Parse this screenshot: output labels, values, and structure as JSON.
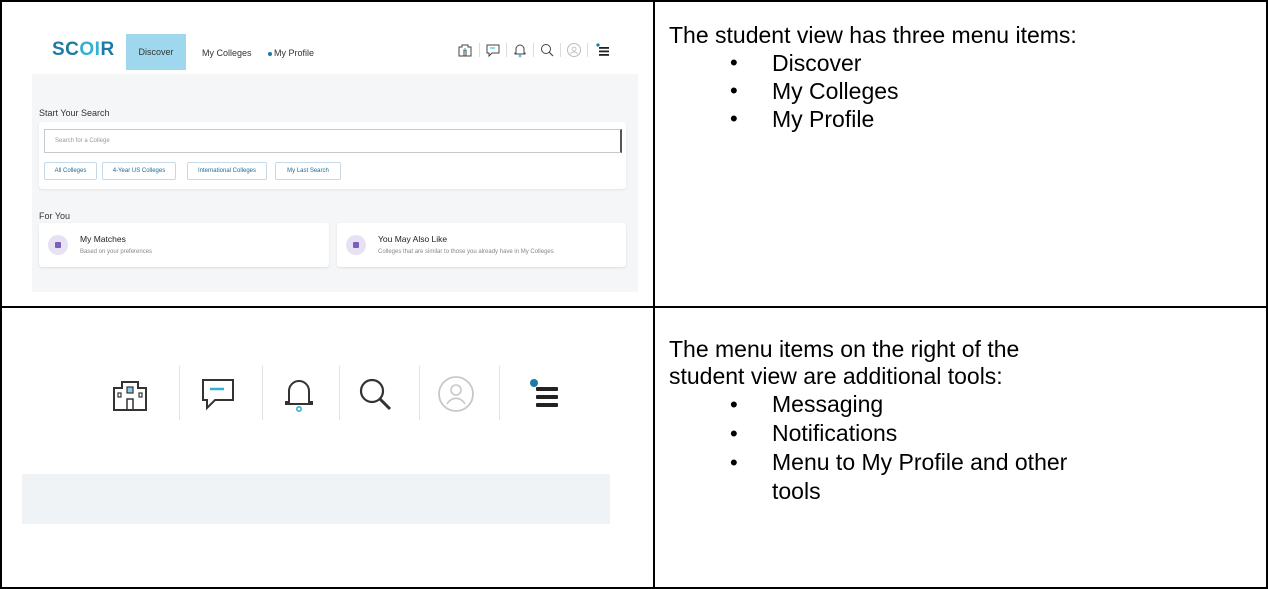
{
  "row1": {
    "screenshot": {
      "logo": {
        "prefix": "SC",
        "oo": "OI",
        "suffix": "R",
        "colors": {
          "dark": "#1b7ba5",
          "light": "#33b0d6"
        }
      },
      "tabs": [
        {
          "label": "Discover",
          "active": true
        },
        {
          "label": "My Colleges"
        },
        {
          "label": "My Profile",
          "indicator": "dot"
        }
      ],
      "nav_icons": [
        "college-building-icon",
        "message-icon",
        "bell-icon",
        "search-icon",
        "avatar-icon",
        "menu-icon"
      ],
      "start_heading": "Start Your Search",
      "search_placeholder": "Search for a College",
      "chips": [
        "All Colleges",
        "4-Year US Colleges",
        "International Colleges",
        "My Last Search"
      ],
      "for_you_heading": "For You",
      "cards": [
        {
          "title": "My Matches",
          "subtitle": "Based on your preferences"
        },
        {
          "title": "You May Also Like",
          "subtitle": "Colleges that are similar to those you already have in My Colleges"
        }
      ],
      "accent_color": "#9fd7ee"
    },
    "description": {
      "intro": "The student view has three menu items:",
      "items": [
        "Discover",
        "My Colleges",
        "My Profile"
      ]
    }
  },
  "row2": {
    "screenshot": {
      "icons": [
        "college-building-icon",
        "message-icon",
        "bell-icon",
        "search-icon",
        "avatar-icon",
        "menu-icon"
      ]
    },
    "description": {
      "intro_line1": "The menu items on the right of the",
      "intro_line2": "student view are additional tools:",
      "items": [
        "Messaging",
        "Notifications",
        "Menu to My Profile and other",
        "tools"
      ]
    }
  }
}
